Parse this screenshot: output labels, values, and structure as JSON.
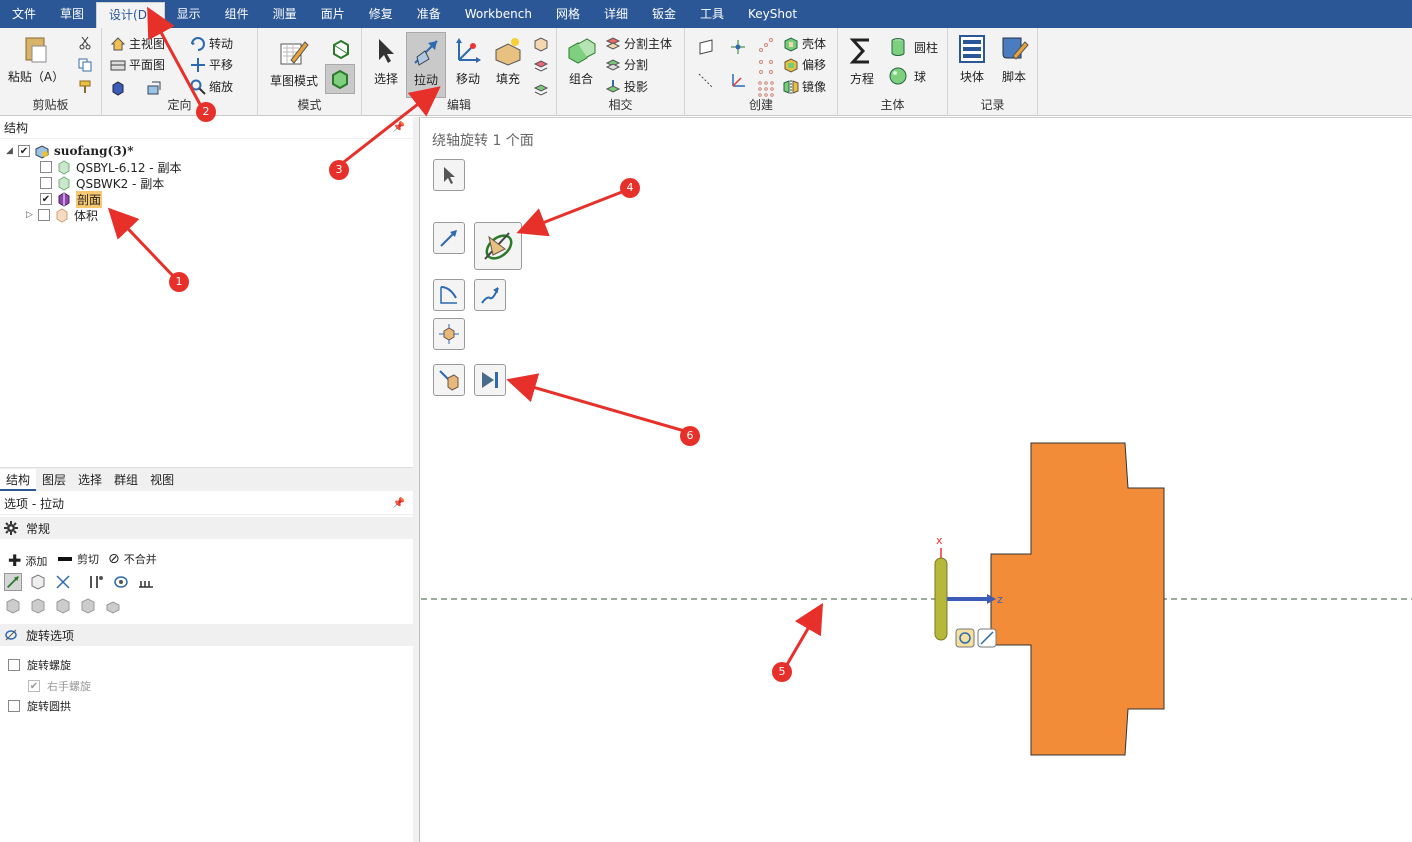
{
  "menu": [
    "文件",
    "草图",
    "设计(D)",
    "显示",
    "组件",
    "测量",
    "面片",
    "修复",
    "准备",
    "Workbench",
    "网格",
    "详细",
    "钣金",
    "工具",
    "KeyShot"
  ],
  "ribbon": {
    "clipboard": {
      "label": "剪贴板",
      "paste": "粘贴（A）"
    },
    "orient": {
      "label": "定向",
      "home": "主视图",
      "plan": "平面图",
      "spin": "转动",
      "pan": "平移",
      "zoom": "缩放"
    },
    "mode": {
      "label": "模式",
      "sketch": "草图模式"
    },
    "edit": {
      "label": "编辑",
      "select": "选择",
      "pull": "拉动",
      "move": "移动",
      "fill": "填充"
    },
    "intersect": {
      "label": "相交",
      "combine": "组合",
      "split_body": "分割主体",
      "split": "分割",
      "project": "投影"
    },
    "create": {
      "label": "创建",
      "shell": "壳体",
      "offset": "偏移",
      "mirror": "镜像"
    },
    "body": {
      "label": "主体",
      "equation": "方程",
      "cylinder": "圆柱",
      "sphere": "球"
    },
    "record": {
      "label": "记录",
      "block": "块体",
      "script": "脚本"
    }
  },
  "structure": {
    "title": "结构",
    "root": "suofang(3)*",
    "items": [
      {
        "label": "QSBYL-6.12 - 副本",
        "checked": false
      },
      {
        "label": "QSBWK2 - 副本",
        "checked": false
      },
      {
        "label": "剖面",
        "checked": true
      },
      {
        "label": "体积",
        "checked": false
      }
    ]
  },
  "tabs": [
    "结构",
    "图层",
    "选择",
    "群组",
    "视图"
  ],
  "options": {
    "title": "选项 - 拉动",
    "general": "常规",
    "add": "添加",
    "cut": "剪切",
    "no_merge": "不合并",
    "rotate_options": "旋转选项",
    "rotate_helix": "旋转螺旋",
    "right_hand": "右手螺旋",
    "rotate_arch": "旋转圆拱"
  },
  "viewport": {
    "title": "绕轴旋转 1 个面",
    "axis_x": "x",
    "axis_z": "z",
    "shape_color": "#f28c38"
  },
  "callouts": [
    "1",
    "2",
    "3",
    "4",
    "5",
    "6"
  ],
  "colors": {
    "menubar": "#2b5797",
    "callout": "#e8302a"
  }
}
